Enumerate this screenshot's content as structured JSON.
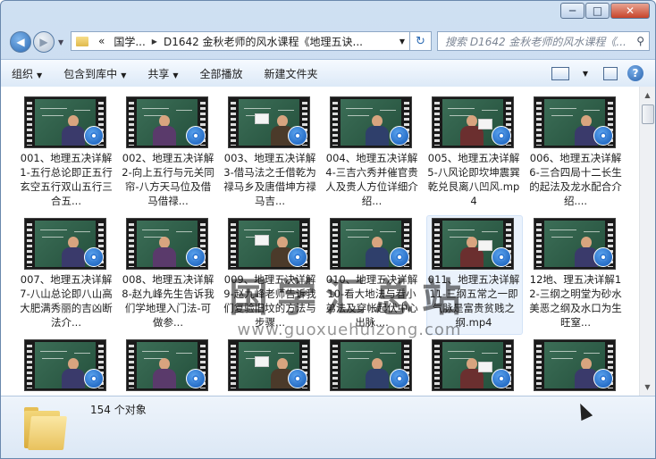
{
  "window": {
    "minimize_label": "─",
    "maximize_label": "□",
    "close_label": "✕"
  },
  "address": {
    "overflow": "«",
    "crumbs": [
      "国学...",
      "D1642 金秋老师的风水课程《地理五诀..."
    ]
  },
  "search": {
    "placeholder": "搜索 D1642 金秋老师的风水课程《..."
  },
  "toolbar": {
    "organize": "组织",
    "include_library": "包含到库中",
    "share": "共享",
    "play_all": "全部播放",
    "new_folder": "新建文件夹"
  },
  "files": [
    {
      "name": "001、地理五决详解1-五行总论即正五行玄空五行双山五行三合五..."
    },
    {
      "name": "002、地理五决详解2-向上五行与元关同帘-八方天马位及借马借禄..."
    },
    {
      "name": "003、地理五决详解3-借马法之壬借乾为禄马乡及唐借坤方禄马吉..."
    },
    {
      "name": "004、地理五决详解4-三吉六秀并催官贵人及贵人方位详细介绍..."
    },
    {
      "name": "005、地理五决详解5-八风论即坎坤震巽乾兑艮离八凹风.mp4"
    },
    {
      "name": "006、地理五决详解6-三合四局十二长生的起法及龙水配合介绍...."
    },
    {
      "name": "007、地理五决详解7-八山总论即八山高大肥满秀丽的吉凶断法介..."
    },
    {
      "name": "008、地理五决详解8-赵九峰先生告诉我们学地理入门法-可做参..."
    },
    {
      "name": "009、地理五决详解9-赵九峰老师告诉我们复验旧坟的方法与步骤..."
    },
    {
      "name": "010、地理五决详解10-看大地法与看小弟法及穿帐起伏中心出脉...."
    },
    {
      "name": "011、地理五决详解11-三纲五常之一即气脉是富贵贫贱之纲.mp4"
    },
    {
      "name": "12地、理五决详解12-三纲之明堂为砂水美恶之纲及水口为生旺窒..."
    },
    {
      "name": ""
    },
    {
      "name": ""
    },
    {
      "name": ""
    },
    {
      "name": ""
    },
    {
      "name": ""
    },
    {
      "name": ""
    }
  ],
  "status": {
    "count": "154 个对象"
  },
  "watermark": {
    "title": "国学汇总站",
    "url": "www.guoxuehuizong.com"
  }
}
